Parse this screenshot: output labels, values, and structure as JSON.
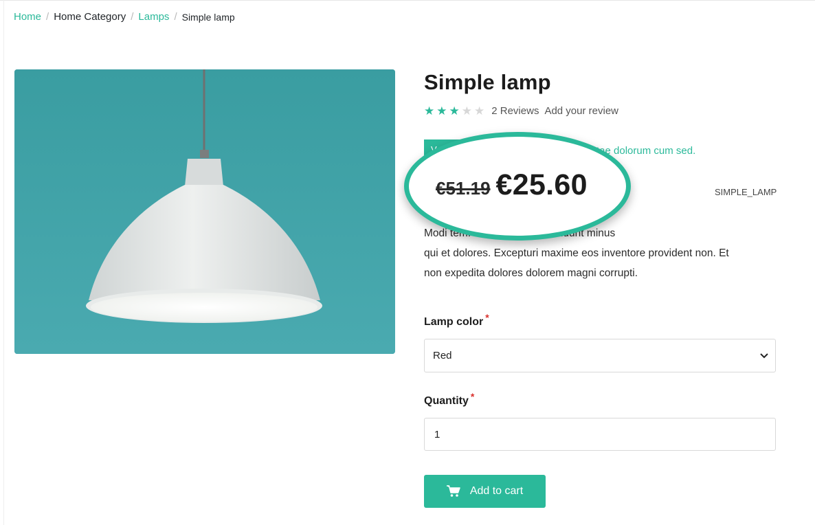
{
  "breadcrumb": {
    "home": "Home",
    "category": "Home Category",
    "sub": "Lamps",
    "current": "Simple lamp",
    "separator": "/"
  },
  "product": {
    "title": "Simple lamp",
    "rating": 3,
    "rating_max": 5,
    "reviews_label": "2 Reviews",
    "add_review": "Add your review",
    "stock_badge": "V",
    "promo_text": "tae dolorum cum sed.",
    "old_price": "€51.19",
    "new_price": "€25.60",
    "sku": "SIMPLE_LAMP",
    "description_lines": [
      "Modi                                tem. Exercitationem incidunt minus",
      "qui et dolores. Excepturi maxime eos inventore provident non. Et",
      "non expedita dolores dolorem magni corrupti."
    ]
  },
  "options": {
    "color_label": "Lamp color",
    "color_value": "Red",
    "qty_label": "Quantity",
    "qty_value": "1",
    "required_mark": "*"
  },
  "actions": {
    "add_to_cart": "Add to cart"
  },
  "colors": {
    "accent": "#2bb99a",
    "required": "#d9302c",
    "image_bg": "#3c9fa3"
  },
  "icons": [
    "star-icon",
    "chevron-down-icon",
    "cart-icon"
  ]
}
